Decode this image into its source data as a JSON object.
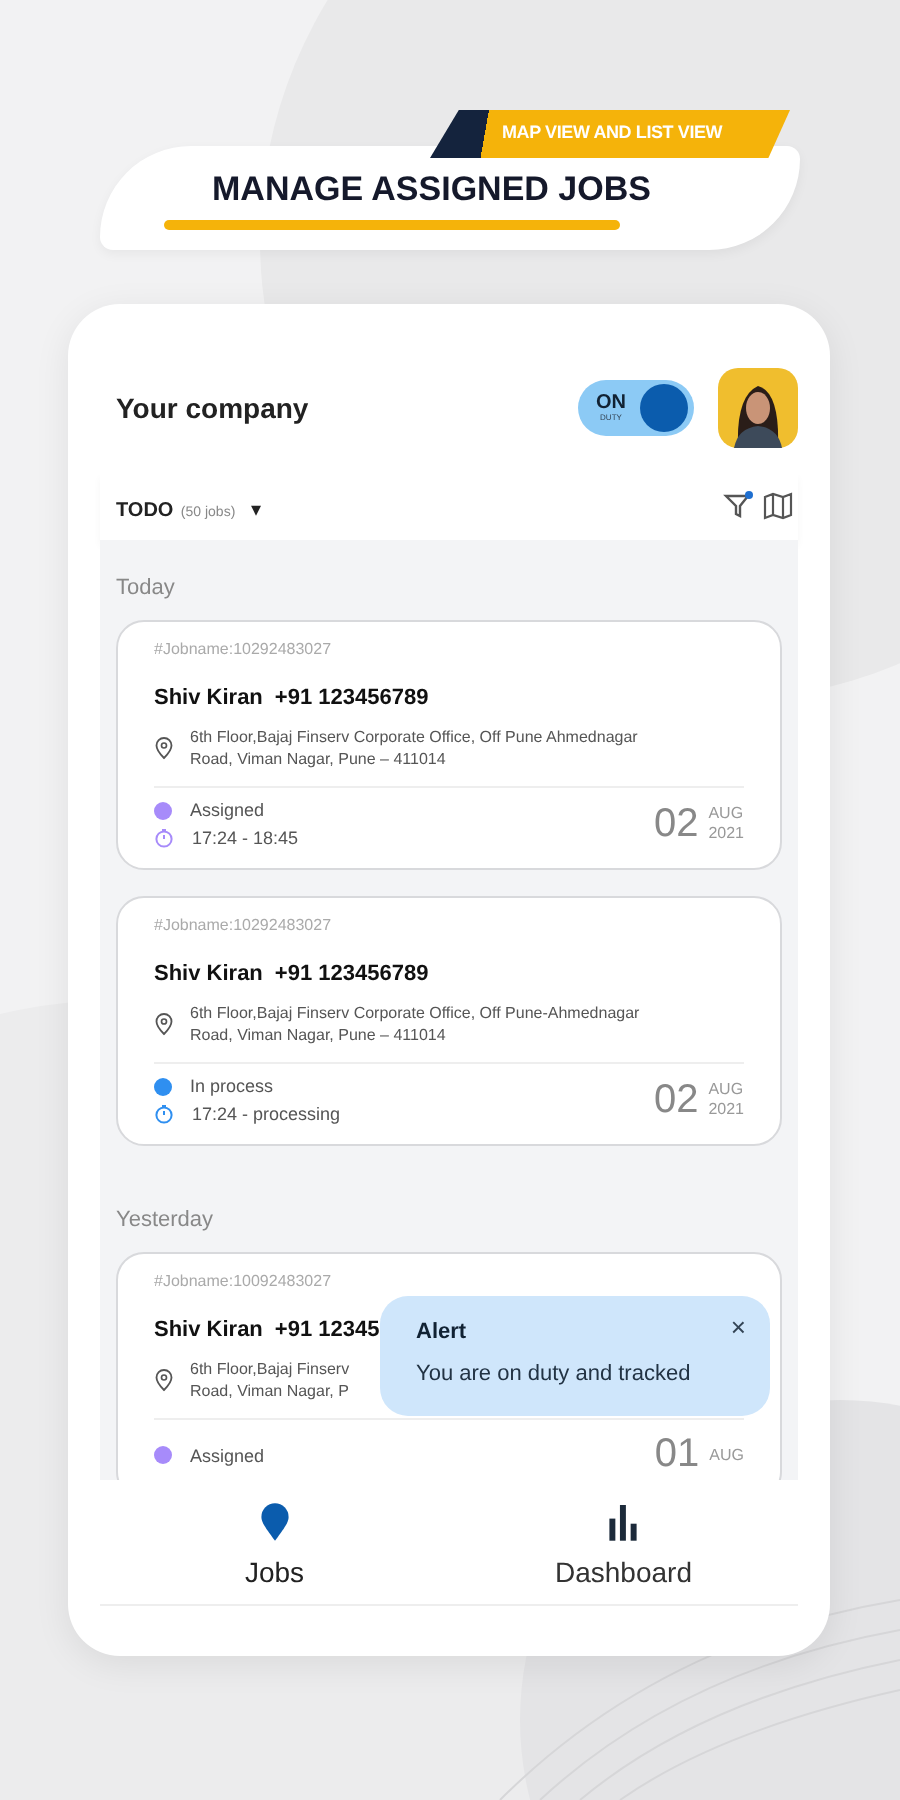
{
  "banner": {
    "subtitle": "MAP VIEW AND LIST VIEW",
    "title": "MANAGE ASSIGNED JOBS"
  },
  "header": {
    "company": "Your company",
    "duty_toggle": {
      "label": "ON",
      "sublabel": "DUTY",
      "on": true
    }
  },
  "filter": {
    "label": "TODO",
    "count": "(50 jobs)",
    "caret": "▾",
    "filter_active": true
  },
  "sections": [
    {
      "heading": "Today",
      "jobs": [
        {
          "job_id": "#Jobname:10292483027",
          "name": "Shiv Kiran",
          "phone": "+91 123456789",
          "address": [
            "6th Floor,Bajaj Finserv Corporate Office, Off Pune Ahmednagar",
            "Road, Viman Nagar, Pune – 411014"
          ],
          "status": "Assigned",
          "color": "#a78bfa",
          "time": "17:24 - 18:45",
          "day": "02",
          "month": "AUG",
          "year": "2021"
        },
        {
          "job_id": "#Jobname:10292483027",
          "name": "Shiv Kiran",
          "phone": "+91 123456789",
          "address": [
            "6th Floor,Bajaj Finserv Corporate Office, Off Pune-Ahmednagar",
            "Road, Viman Nagar, Pune – 411014"
          ],
          "status": "In process",
          "color": "#2f8ff0",
          "time": "17:24 - processing",
          "day": "02",
          "month": "AUG",
          "year": "2021"
        }
      ]
    },
    {
      "heading": "Yesterday",
      "jobs": [
        {
          "job_id": "#Jobname:10092483027",
          "name": "Shiv Kiran",
          "phone": "+91 12345",
          "address": [
            "6th Floor,Bajaj Finserv",
            "Road, Viman Nagar, P"
          ],
          "status": "Assigned",
          "color": "#a78bfa",
          "day": "01",
          "month": "AUG"
        }
      ]
    }
  ],
  "alert": {
    "title": "Alert",
    "message": "You are on duty and tracked",
    "close": "×"
  },
  "nav": [
    {
      "label": "Jobs",
      "kind": "pin",
      "selected": true
    },
    {
      "label": "Dashboard",
      "kind": "bars",
      "selected": false
    }
  ]
}
